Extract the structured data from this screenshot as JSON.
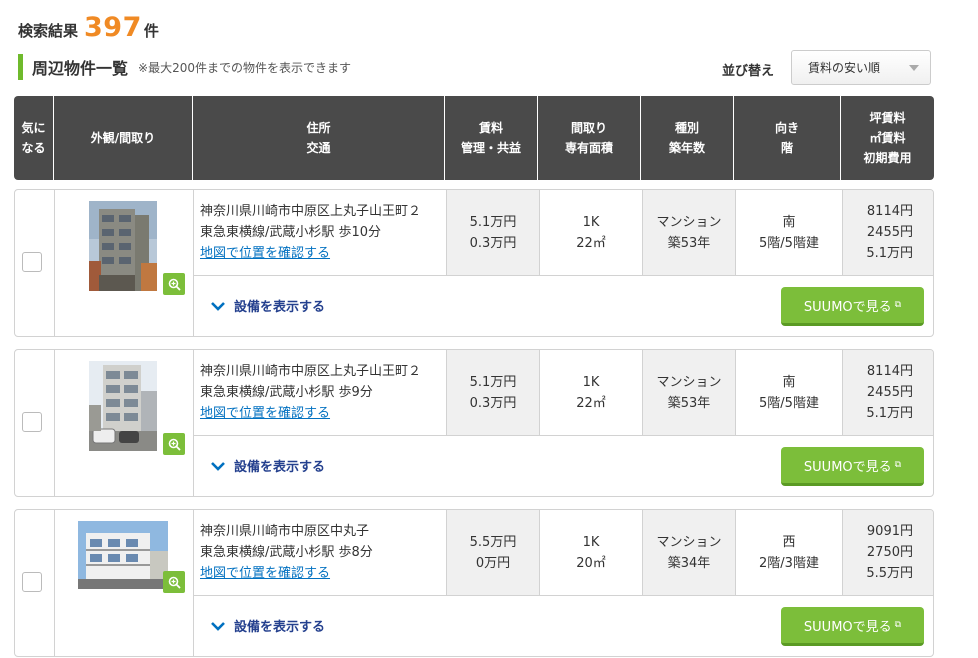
{
  "header": {
    "results_label": "検索結果",
    "results_count": "397",
    "results_unit": "件"
  },
  "section": {
    "title": "周辺物件一覧",
    "note": "※最大200件までの物件を表示できます"
  },
  "sort": {
    "label": "並び替え",
    "selected": "賃料の安い順"
  },
  "table_headers": {
    "favorite": [
      "気に",
      "なる"
    ],
    "photo": [
      "外観/間取り"
    ],
    "address": [
      "住所",
      "交通"
    ],
    "rent": [
      "賃料",
      "管理・共益"
    ],
    "layout": [
      "間取り",
      "専有面積"
    ],
    "type": [
      "種別",
      "築年数"
    ],
    "direction": [
      "向き",
      "階"
    ],
    "cost": [
      "坪賃料",
      "㎡賃料",
      "初期費用"
    ]
  },
  "listings": [
    {
      "address": "神奈川県川崎市中原区上丸子山王町２",
      "station": "東急東横線/武蔵小杉駅 歩10分",
      "map_link": "地図で位置を確認する",
      "rent": "5.1万円",
      "fee": "0.3万円",
      "layout": "1K",
      "area": "22㎡",
      "type": "マンション",
      "age": "築53年",
      "direction": "南",
      "floor": "5階/5階建",
      "tsubo_rent": "8114円",
      "sqm_rent": "2455円",
      "initial_cost": "5.1万円",
      "facility_label": "設備を表示する",
      "suumo_label": "SUUMOで見る"
    },
    {
      "address": "神奈川県川崎市中原区上丸子山王町２",
      "station": "東急東横線/武蔵小杉駅 歩9分",
      "map_link": "地図で位置を確認する",
      "rent": "5.1万円",
      "fee": "0.3万円",
      "layout": "1K",
      "area": "22㎡",
      "type": "マンション",
      "age": "築53年",
      "direction": "南",
      "floor": "5階/5階建",
      "tsubo_rent": "8114円",
      "sqm_rent": "2455円",
      "initial_cost": "5.1万円",
      "facility_label": "設備を表示する",
      "suumo_label": "SUUMOで見る"
    },
    {
      "address": "神奈川県川崎市中原区中丸子",
      "station": "東急東横線/武蔵小杉駅 歩8分",
      "map_link": "地図で位置を確認する",
      "rent": "5.5万円",
      "fee": "0万円",
      "layout": "1K",
      "area": "20㎡",
      "type": "マンション",
      "age": "築34年",
      "direction": "西",
      "floor": "2階/3階建",
      "tsubo_rent": "9091円",
      "sqm_rent": "2750円",
      "initial_cost": "5.5万円",
      "facility_label": "設備を表示する",
      "suumo_label": "SUUMOで見る"
    }
  ],
  "colors": {
    "accent_orange": "#f08a24",
    "brand_green": "#7cbe3a",
    "header_dark": "#4a4a4a",
    "link_blue": "#0070c0"
  }
}
